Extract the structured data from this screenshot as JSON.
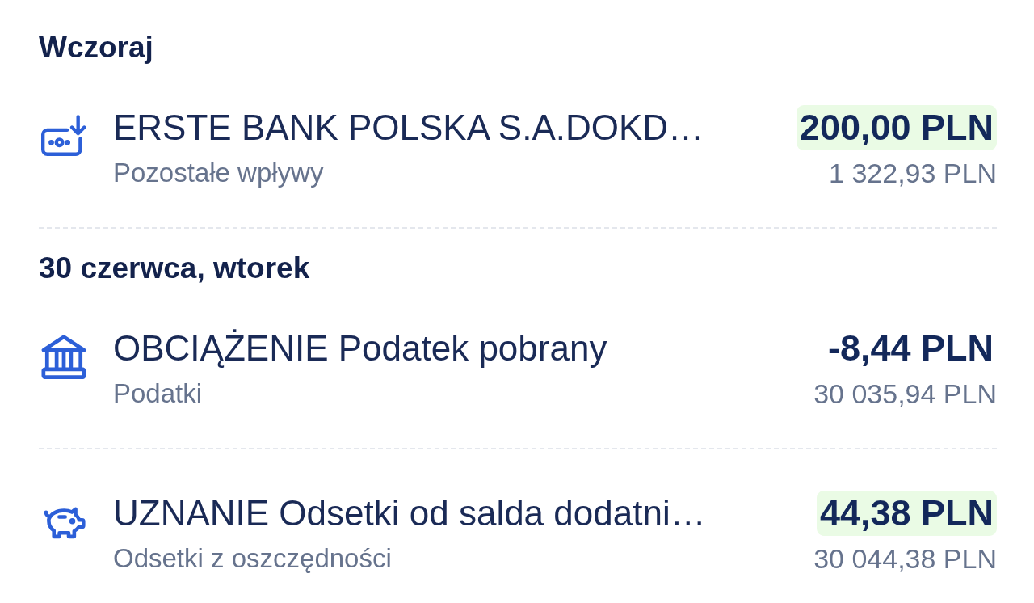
{
  "sections": [
    {
      "heading": "Wczoraj",
      "transactions": [
        {
          "kind": "deposit",
          "title": "ERSTE BANK POLSKA S.A.DOKD…",
          "category": "Pozostałe wpływy",
          "amount": "200,00 PLN",
          "highlighted": true,
          "balance": "1 322,93 PLN"
        }
      ]
    },
    {
      "heading": "30 czerwca, wtorek",
      "transactions": [
        {
          "kind": "tax",
          "title": "OBCIĄŻENIE Podatek pobrany",
          "category": "Podatki",
          "amount": "-8,44 PLN",
          "highlighted": false,
          "balance": "30 035,94 PLN"
        },
        {
          "kind": "interest",
          "title": "UZNANIE Odsetki od salda dodatni…",
          "category": "Odsetki z oszczędności",
          "amount": "44,38 PLN",
          "highlighted": true,
          "balance": "30 044,38 PLN"
        }
      ]
    }
  ]
}
